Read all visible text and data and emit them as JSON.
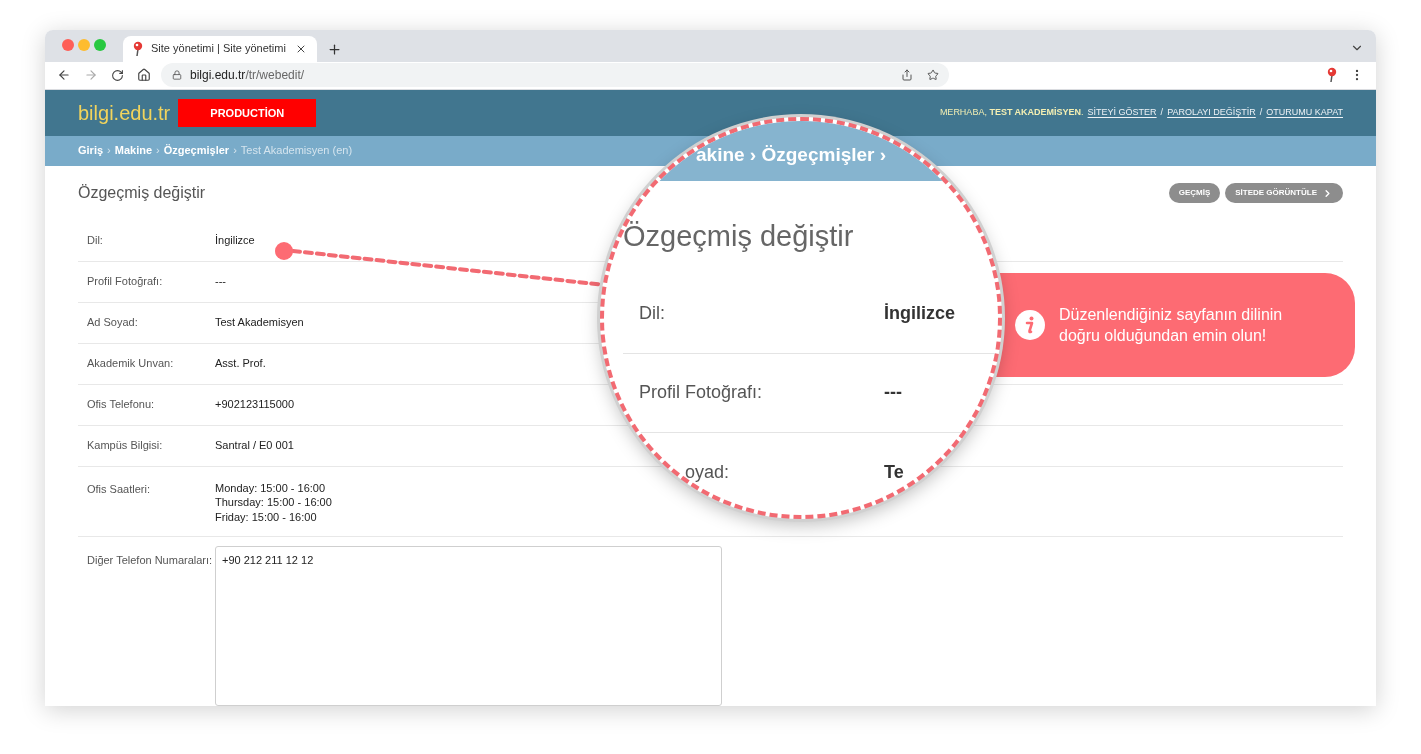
{
  "browser": {
    "tab_title": "Site yönetimi | Site yönetimi",
    "url_host": "bilgi.edu.tr",
    "url_path": "/tr/webedit/"
  },
  "header": {
    "logo": "bilgi.edu.tr",
    "badge": "PRODUCTİON",
    "greeting": "MERHABA, **TEST AKADEMİSYEN**.",
    "links": [
      {
        "label": "SİTEYİ GÖSTER",
        "kind": "link"
      },
      {
        "label": "/",
        "kind": "sep"
      },
      {
        "label": "PAROLAYI DEĞİŞTİR",
        "kind": "link"
      },
      {
        "label": "/",
        "kind": "sep"
      },
      {
        "label": "OTURUMU KAPAT",
        "kind": "link"
      }
    ]
  },
  "breadcrumb": [
    {
      "label": "Giriş",
      "kind": "link"
    },
    {
      "label": "›",
      "kind": "sep"
    },
    {
      "label": "Makine",
      "kind": "link"
    },
    {
      "label": "›",
      "kind": "sep"
    },
    {
      "label": "Özgeçmişler",
      "kind": "link"
    },
    {
      "label": "›",
      "kind": "sep"
    },
    {
      "label": "Test Akademisyen (en)",
      "kind": "current"
    }
  ],
  "page": {
    "title": "Özgeçmiş değiştir",
    "buttons": [
      {
        "label": "GEÇMİŞ",
        "chevron": false
      },
      {
        "label": "SİTEDE GÖRÜNTÜLE",
        "chevron": true
      }
    ]
  },
  "rows": [
    {
      "label": "Dil:",
      "kind": "text",
      "value": "İngilizce"
    },
    {
      "label": "Profil Fotoğrafı:",
      "kind": "text",
      "value": "---"
    },
    {
      "label": "Ad Soyad:",
      "kind": "text",
      "value": "Test Akademisyen"
    },
    {
      "label": "Akademik Unvan:",
      "kind": "text",
      "value": "Asst. Prof."
    },
    {
      "label": "Ofis Telefonu:",
      "kind": "text",
      "value": "+902123115000"
    },
    {
      "label": "Kampüs Bilgisi:",
      "kind": "text",
      "value": "Santral / E0 001"
    },
    {
      "label": "Ofis Saatleri:",
      "kind": "lines",
      "lines": [
        "Monday: 15:00 - 16:00",
        "Thursday: 15:00 - 16:00",
        "Friday: 15:00 - 16:00"
      ]
    },
    {
      "label": "Diğer Telefon Numaraları:",
      "kind": "textarea",
      "value": "+90 212 211 12 12"
    }
  ],
  "magnifier": {
    "breadcrumb": "akine › Özgeçmişler ›",
    "title": "Özgeçmiş değiştir",
    "rows": [
      {
        "label": "Dil:",
        "value": "İngilizce"
      },
      {
        "label": "Profil Fotoğrafı:",
        "value": "---"
      },
      {
        "label": "oyad:",
        "value": "Te"
      }
    ]
  },
  "callout": {
    "text": "Düzenlendiğiniz sayfanın dilinin doğru olduğundan emin olun!"
  }
}
